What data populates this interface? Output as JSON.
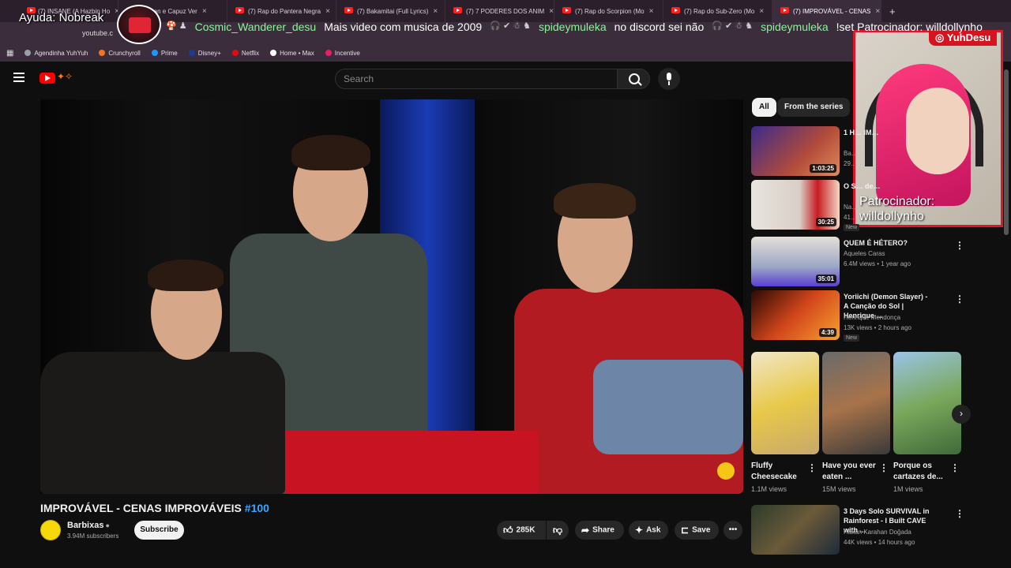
{
  "browser": {
    "tabs": [
      {
        "label": "(7) INSANE (A Hazbin Ho"
      },
      {
        "label": "Batman e Capuz Ver"
      },
      {
        "label": "(7) Rap do Pantera Negra"
      },
      {
        "label": "(7) Bakamitai (Full Lyrics)"
      },
      {
        "label": "(7) 7 PODERES DOS ANIM"
      },
      {
        "label": "(7) Rap do Scorpion (Mo"
      },
      {
        "label": "(7) Rap do Sub-Zero (Mo"
      },
      {
        "label": "(7) IMPROVÁVEL - CENAS"
      }
    ],
    "new_tab_label": "+",
    "address": "youtube.c",
    "bookmarks": [
      "Agendinha YuhYuh",
      "Crunchyroll",
      "Prime",
      "Disney+",
      "Netflix",
      "Home • Max",
      "Incentive"
    ]
  },
  "overlay": {
    "help_text": "Ayuda: Nobreak",
    "ticker": [
      {
        "emotes": "🍄 ♟",
        "user": "Cosmic_Wanderer_desu",
        "message": "Mais video com musica de 2009"
      },
      {
        "emotes": "🎧 ✔ ☃ ♞",
        "user": "spideymuleka",
        "message": "no discord sei não"
      },
      {
        "emotes": "🎧 ✔ ☃ ♞",
        "user": "spideymuleka",
        "message": "!set Patrocinador: willdollynho"
      }
    ],
    "cam_tag": "YuhDesu",
    "cam_sponsor_line1": "Patrocinador:",
    "cam_sponsor_line2": "willdollynho"
  },
  "youtube": {
    "search_placeholder": "Search",
    "video": {
      "title_main": "IMPROVÁVEL - CENAS IMPROVÁVEIS ",
      "title_hash": "#100",
      "channel": "Barbixas",
      "subscribers": "3.94M subscribers",
      "subscribe_label": "Subscribe",
      "likes": "285K",
      "share_label": "Share",
      "ask_label": "Ask",
      "save_label": "Save"
    },
    "chips": [
      "All",
      "From the series"
    ],
    "recommendations": [
      {
        "title": "1 H… IM…",
        "channel": "Ba…",
        "meta": "29…",
        "duration": "1:03:25",
        "new": ""
      },
      {
        "title": "O S… de…",
        "channel": "Na…",
        "meta": "41…",
        "duration": "30:25",
        "new": "New"
      },
      {
        "title": "QUEM É HÉTERO?",
        "channel": "Aqueles Caras",
        "meta": "6.4M views • 1 year ago",
        "duration": "35:01",
        "new": ""
      },
      {
        "title": "Yoriichi (Demon Slayer) - A Canção do Sol | Henrique ...",
        "channel": "Henrique Mendonça",
        "meta": "13K views • 2 hours ago",
        "duration": "4:39",
        "new": "New"
      },
      {
        "title": "3 Days Solo SURVIVAL in Rainforest - I Built CAVE with ...",
        "channel": "Hakan Karahan Doğada",
        "meta": "44K views • 14 hours ago",
        "duration": "",
        "new": ""
      }
    ],
    "shorts": [
      {
        "title": "Fluffy Cheesecake",
        "views": "1.1M views"
      },
      {
        "title": "Have you ever eaten ...",
        "views": "15M views"
      },
      {
        "title": "Porque os cartazes de...",
        "views": "1M views"
      }
    ]
  },
  "colors": {
    "accent": "#ff0000",
    "link": "#3ea6ff",
    "chat_user": "#8cf29b",
    "cam_border": "#e3142a"
  }
}
